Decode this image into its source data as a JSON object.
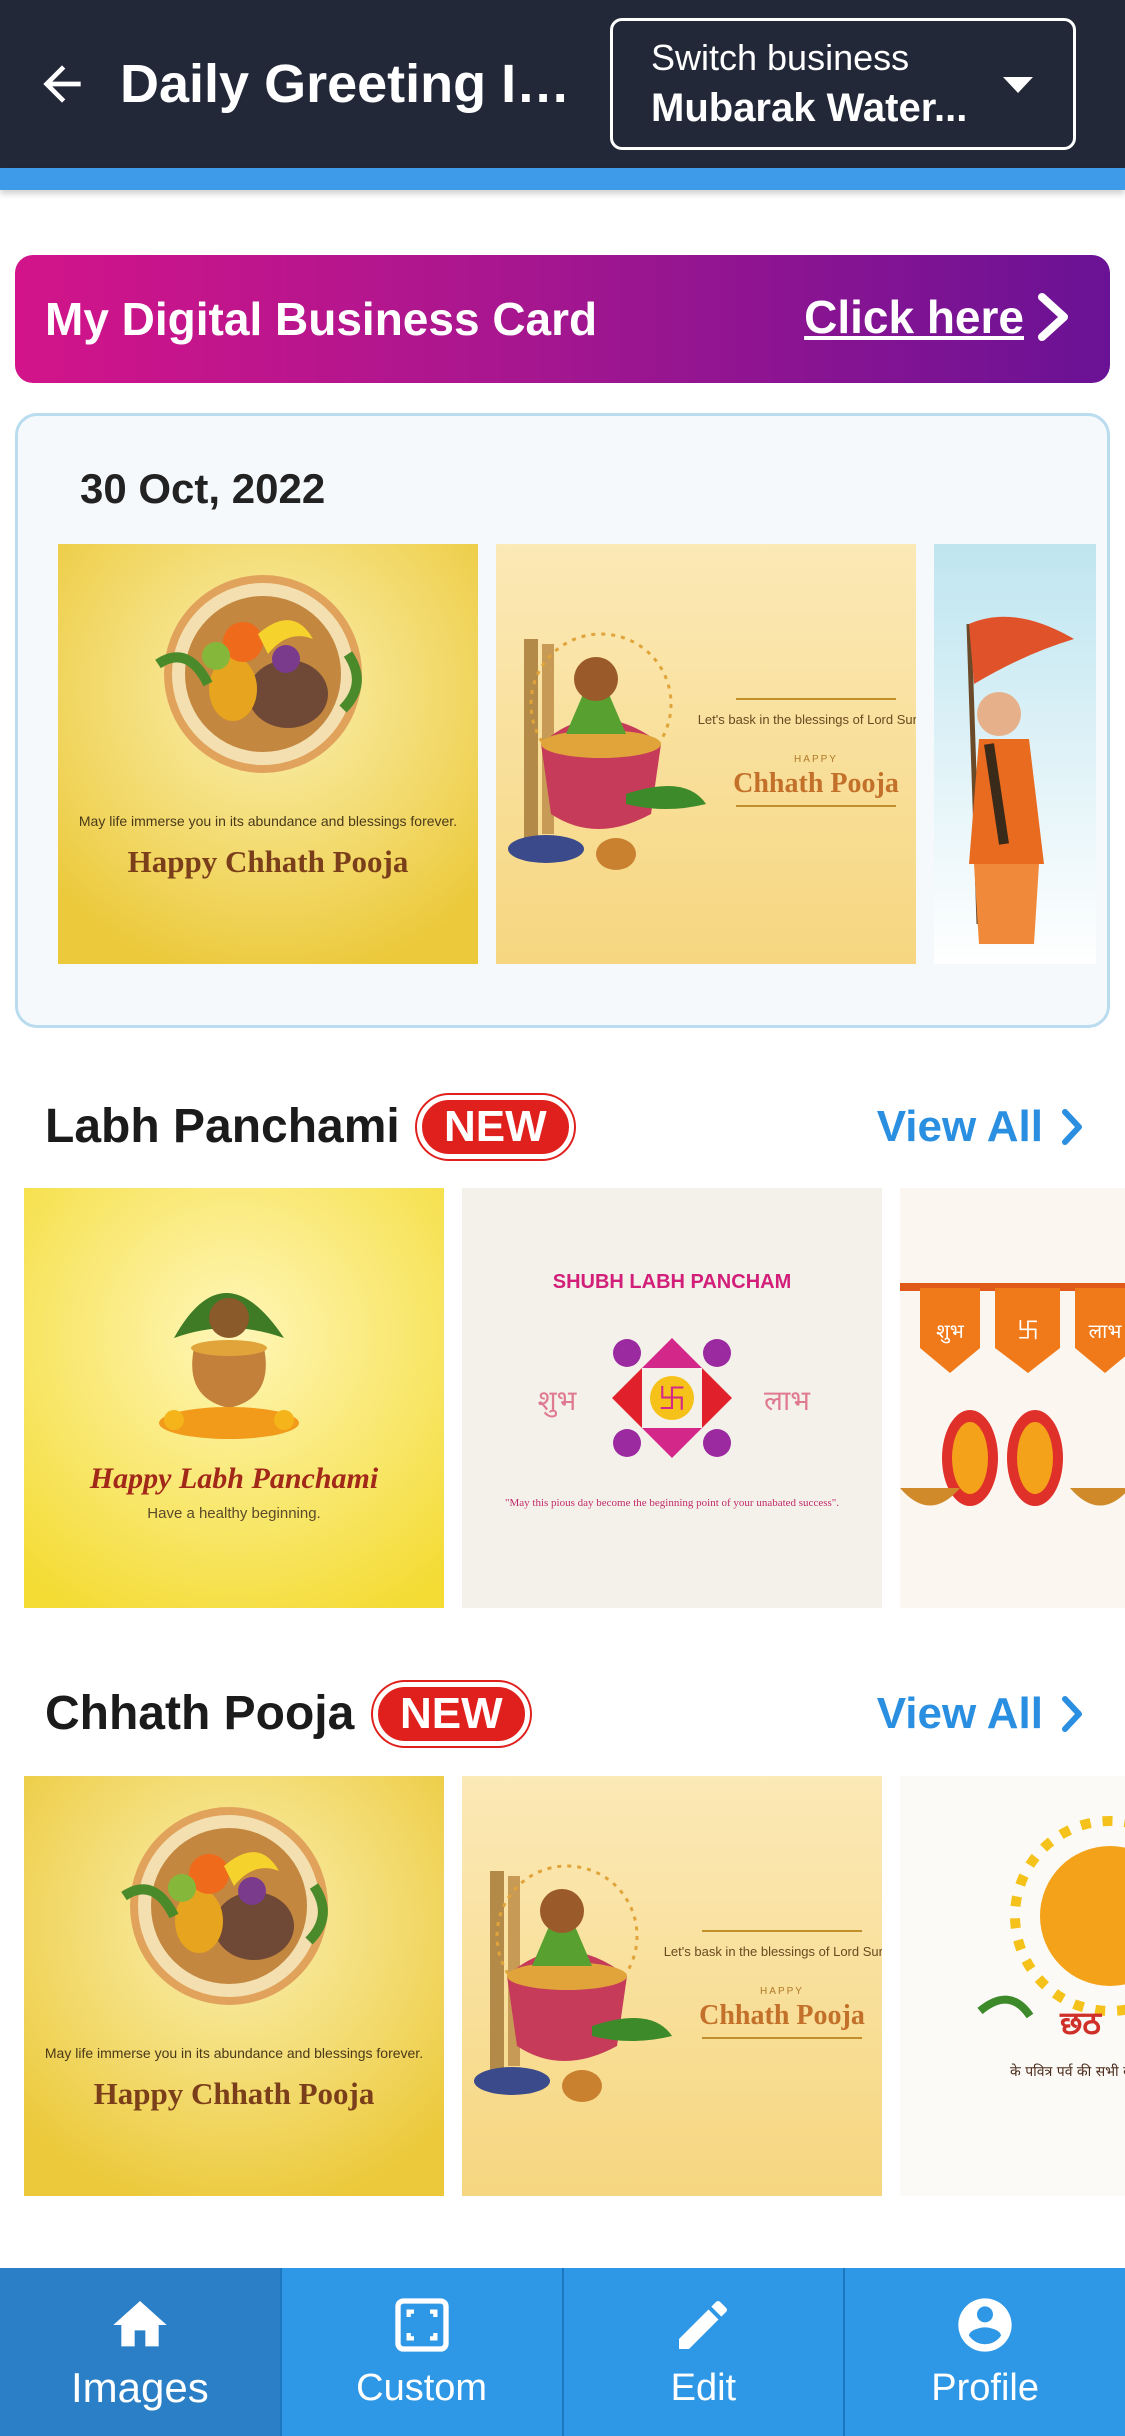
{
  "header": {
    "title": "Daily Greeting Ima...",
    "switch_label": "Switch business",
    "switch_value": "Mubarak Water..."
  },
  "banner": {
    "title": "My Digital Business Card",
    "link": "Click here"
  },
  "date_section": {
    "date": "30 Oct, 2022",
    "images": [
      {
        "caption_small": "May life immerse you in its abundance and blessings forever.",
        "caption_big": "Happy Chhath Pooja"
      },
      {
        "caption_small": "Let's bask in the blessings of Lord Surya.",
        "caption_mid": "HAPPY",
        "caption_big": "Chhath Pooja"
      },
      {
        "caption_small": "",
        "caption_big": ""
      }
    ]
  },
  "sections": [
    {
      "title": "Labh Panchami",
      "badge": "NEW",
      "view_all": "View All",
      "images": [
        {
          "caption_big": "Happy Labh Panchami",
          "caption_small": "Have a healthy beginning."
        },
        {
          "caption_top": "SHUBH LABH PANCHAM",
          "left_word": "शुभ",
          "right_word": "लाभ",
          "caption_small": "\"May this pious day become the beginning point of your unabated success\"."
        },
        {
          "words": [
            "शुभ",
            "卐",
            "लाभ"
          ]
        }
      ]
    },
    {
      "title": "Chhath Pooja",
      "badge": "NEW",
      "view_all": "View All",
      "images": [
        {
          "caption_small": "May life immerse you in its abundance and blessings forever.",
          "caption_big": "Happy Chhath Pooja"
        },
        {
          "caption_small": "Let's bask in the blessings of Lord Surya.",
          "caption_mid": "HAPPY",
          "caption_big": "Chhath Pooja"
        },
        {
          "caption_big": "छठ",
          "caption_small": "के पवित्र पर्व की सभी को हार्दिक"
        }
      ]
    }
  ],
  "nav": [
    {
      "label": "Images",
      "icon": "home-icon",
      "active": true
    },
    {
      "label": "Custom",
      "icon": "custom-frame-icon",
      "active": false
    },
    {
      "label": "Edit",
      "icon": "pencil-icon",
      "active": false
    },
    {
      "label": "Profile",
      "icon": "profile-icon",
      "active": false
    }
  ],
  "colors": {
    "appbar": "#232838",
    "accent": "#3d9be9",
    "banner_start": "#d3148a",
    "banner_end": "#6a1295",
    "link_blue": "#2a8fe0",
    "badge_red": "#e0201d",
    "nav_bg": "#2f98e6"
  }
}
